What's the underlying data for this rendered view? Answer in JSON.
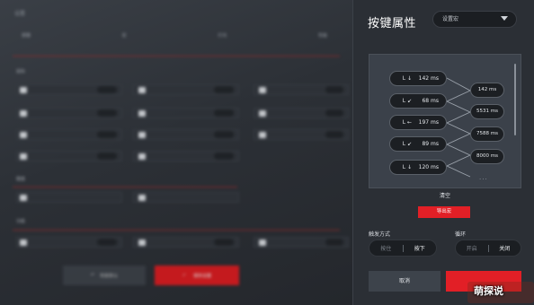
{
  "background_view": {
    "title": "设置",
    "tabs": [
      "按键",
      "宏",
      "灯光",
      "性能"
    ],
    "sections": [
      "鼠标",
      "键盘",
      "功能"
    ],
    "left_button_label": "恢复默认",
    "right_button_label": "保存设置"
  },
  "panel": {
    "title": "按键属性",
    "macro_select": {
      "value": "设置宏"
    },
    "sequence": {
      "keys": [
        {
          "key": "L ↓",
          "time": "142 ms"
        },
        {
          "key": "L ↙",
          "time": "68 ms"
        },
        {
          "key": "L ←",
          "time": "197 ms"
        },
        {
          "key": "L ↙",
          "time": "89 ms"
        },
        {
          "key": "L ↓",
          "time": "120 ms"
        }
      ],
      "delays": [
        "142 ms",
        "5531 ms",
        "7588 ms",
        "8000 ms"
      ],
      "more": "···"
    },
    "clear_label": "清空",
    "export_button": "导出宏",
    "trigger": {
      "label": "触发方式",
      "options": [
        "按住",
        "按下"
      ],
      "selected": "按下"
    },
    "loop": {
      "label": "循环",
      "options": [
        "开启",
        "关闭"
      ],
      "selected": "关闭"
    },
    "cancel_button": "取消",
    "ok_button": ""
  },
  "watermark": "萌探说",
  "colors": {
    "accent": "#e21f26",
    "panel_bg": "#2b2f35",
    "sequence_bg": "#3b414a"
  }
}
